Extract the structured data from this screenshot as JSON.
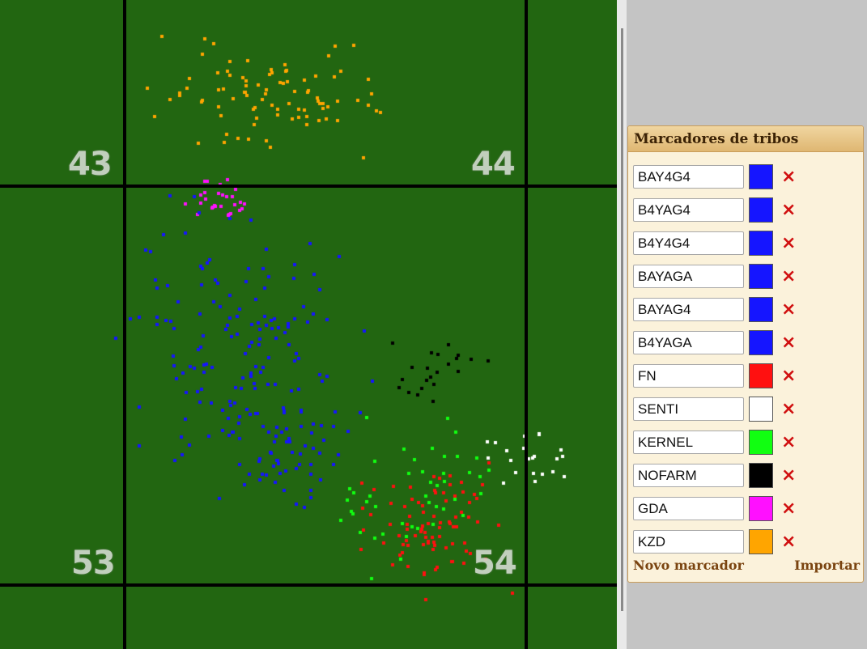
{
  "map": {
    "background": "#226611",
    "grid_labels": [
      "43",
      "44",
      "53",
      "54"
    ],
    "markers": [
      {
        "name": "BAY4G4",
        "color": "#1515ff"
      },
      {
        "name": "B4YAG4",
        "color": "#1515ff"
      },
      {
        "name": "B4Y4G4",
        "color": "#1515ff"
      },
      {
        "name": "BAYAGA",
        "color": "#1515ff"
      },
      {
        "name": "BAYAG4",
        "color": "#1515ff"
      },
      {
        "name": "B4YAGA",
        "color": "#1515ff"
      },
      {
        "name": "FN",
        "color": "#ff1010"
      },
      {
        "name": "SENTI",
        "color": "#ffffff"
      },
      {
        "name": "KERNEL",
        "color": "#11ff11"
      },
      {
        "name": "NOFARM",
        "color": "#000000"
      },
      {
        "name": "GDA",
        "color": "#ff10ff"
      },
      {
        "name": "KZD",
        "color": "#ffa500"
      }
    ]
  },
  "panel": {
    "title": "Marcadores de tribos",
    "rows": [
      {
        "value": "BAY4G4",
        "color": "#1515ff"
      },
      {
        "value": "B4YAG4",
        "color": "#1515ff"
      },
      {
        "value": "B4Y4G4",
        "color": "#1515ff"
      },
      {
        "value": "BAYAGA",
        "color": "#1515ff"
      },
      {
        "value": "BAYAG4",
        "color": "#1515ff"
      },
      {
        "value": "B4YAGA",
        "color": "#1515ff"
      },
      {
        "value": "FN",
        "color": "#ff1010"
      },
      {
        "value": "SENTI",
        "color": "#ffffff"
      },
      {
        "value": "KERNEL",
        "color": "#11ff11"
      },
      {
        "value": "NOFARM",
        "color": "#000000"
      },
      {
        "value": "GDA",
        "color": "#ff10ff"
      },
      {
        "value": "KZD",
        "color": "#ffa500"
      }
    ],
    "delete_icon": "×",
    "new_marker": "Novo marcador",
    "import": "Importar"
  }
}
